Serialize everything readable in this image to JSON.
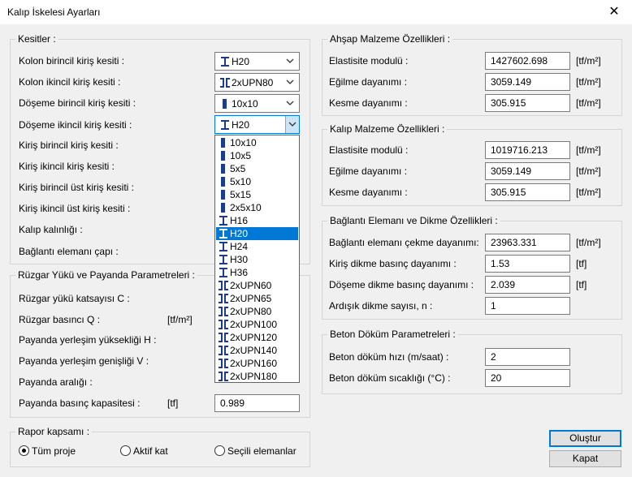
{
  "window": {
    "title": "Kalıp İskelesi Ayarları",
    "close_glyph": "✕"
  },
  "kesitler": {
    "title": "Kesitler :",
    "labels": [
      "Kolon birincil kiriş kesiti :",
      "Kolon ikincil kiriş kesiti :",
      "Döşeme birincil kiriş kesiti :",
      "Döşeme ikincil kiriş kesiti :",
      "Kiriş birincil kiriş kesiti :",
      "Kiriş ikincil kiriş kesiti :",
      "Kiriş birincil üst kiriş kesiti :",
      "Kiriş ikincil üst kiriş kesiti :",
      "Kalıp kalınlığı :",
      "Bağlantı elemanı çapı :"
    ],
    "combos": [
      {
        "value": "H20",
        "icon": "i-beam-icon"
      },
      {
        "value": "2xUPN80",
        "icon": "double-channel-icon"
      },
      {
        "value": "10x10",
        "icon": "timber-section-icon"
      },
      {
        "value": "H20",
        "icon": "i-beam-icon"
      }
    ]
  },
  "dropdown": {
    "items": [
      {
        "label": "10x10",
        "icon": "timber-section-icon"
      },
      {
        "label": "10x5",
        "icon": "timber-section-icon"
      },
      {
        "label": "5x5",
        "icon": "timber-section-icon"
      },
      {
        "label": "5x10",
        "icon": "timber-section-icon"
      },
      {
        "label": "5x15",
        "icon": "timber-section-icon"
      },
      {
        "label": "2x5x10",
        "icon": "timber-section-icon"
      },
      {
        "label": "H16",
        "icon": "i-beam-icon"
      },
      {
        "label": "H20",
        "icon": "i-beam-icon"
      },
      {
        "label": "H24",
        "icon": "i-beam-icon"
      },
      {
        "label": "H30",
        "icon": "i-beam-icon"
      },
      {
        "label": "H36",
        "icon": "i-beam-icon"
      },
      {
        "label": "2xUPN60",
        "icon": "double-channel-icon"
      },
      {
        "label": "2xUPN65",
        "icon": "double-channel-icon"
      },
      {
        "label": "2xUPN80",
        "icon": "double-channel-icon"
      },
      {
        "label": "2xUPN100",
        "icon": "double-channel-icon"
      },
      {
        "label": "2xUPN120",
        "icon": "double-channel-icon"
      },
      {
        "label": "2xUPN140",
        "icon": "double-channel-icon"
      },
      {
        "label": "2xUPN160",
        "icon": "double-channel-icon"
      },
      {
        "label": "2xUPN180",
        "icon": "double-channel-icon"
      }
    ],
    "selected": "H20"
  },
  "ruzgar": {
    "title": "Rüzgar Yükü ve Payanda Parametreleri :",
    "labels": [
      "Rüzgar yükü katsayısı C :",
      "Rüzgar basıncı Q :",
      "Payanda yerleşim yüksekliği H :",
      "Payanda yerleşim genişliği V :",
      "Payanda aralığı :",
      "Payanda basınç kapasitesi :"
    ],
    "units": {
      "basinc": "[tf/m²]",
      "kapasite": "[tf]"
    },
    "kapasite_value": "0.989"
  },
  "rapor": {
    "title": "Rapor kapsamı :",
    "options": [
      "Tüm proje",
      "Aktif kat",
      "Seçili elemanlar"
    ],
    "selected": "Tüm proje"
  },
  "ahsap": {
    "title": "Ahşap Malzeme Özellikleri :",
    "rows": [
      {
        "label": "Elastisite modulü :",
        "value": "1427602.698",
        "unit": "[tf/m²]"
      },
      {
        "label": "Eğilme dayanımı :",
        "value": "3059.149",
        "unit": "[tf/m²]"
      },
      {
        "label": "Kesme dayanımı :",
        "value": "305.915",
        "unit": "[tf/m²]"
      }
    ]
  },
  "kalip": {
    "title": "Kalıp Malzeme Özellikleri :",
    "rows": [
      {
        "label": "Elastisite modulü :",
        "value": "1019716.213",
        "unit": "[tf/m²]"
      },
      {
        "label": "Eğilme dayanımı :",
        "value": "3059.149",
        "unit": "[tf/m²]"
      },
      {
        "label": "Kesme dayanımı :",
        "value": "305.915",
        "unit": "[tf/m²]"
      }
    ]
  },
  "baglanti": {
    "title": "Bağlantı Elemanı ve Dikme Özellikleri :",
    "rows": [
      {
        "label": "Bağlantı elemanı çekme dayanımı:",
        "value": "23963.331",
        "unit": "[tf/m²]"
      },
      {
        "label": "Kiriş dikme basınç dayanımı :",
        "value": "1.53",
        "unit": "[tf]"
      },
      {
        "label": "Döşeme dikme basınç dayanımı :",
        "value": "2.039",
        "unit": "[tf]"
      },
      {
        "label": "Ardışık dikme sayısı, n :",
        "value": "1",
        "unit": ""
      }
    ]
  },
  "beton": {
    "title": "Beton Döküm Parametreleri :",
    "rows": [
      {
        "label": "Beton döküm hızı (m/saat) :",
        "value": "2"
      },
      {
        "label": "Beton döküm sıcaklığı (°C) :",
        "value": "20"
      }
    ]
  },
  "buttons": {
    "olustur": "Oluştur",
    "kapat": "Kapat"
  }
}
